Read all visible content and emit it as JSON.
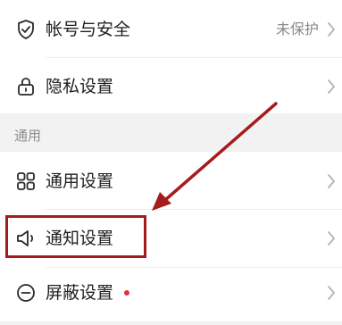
{
  "settings": {
    "account_security": {
      "label": "帐号与安全",
      "value": "未保护",
      "icon": "shield-check-icon"
    },
    "privacy": {
      "label": "隐私设置",
      "icon": "lock-icon"
    },
    "section_general": "通用",
    "general": {
      "label": "通用设置",
      "icon": "grid-icon"
    },
    "notification": {
      "label": "通知设置",
      "icon": "speaker-icon"
    },
    "block": {
      "label": "屏蔽设置",
      "icon": "minus-circle-icon",
      "has_badge": true
    }
  },
  "colors": {
    "annotation": "#a51c1e",
    "badge": "#e0313c"
  }
}
